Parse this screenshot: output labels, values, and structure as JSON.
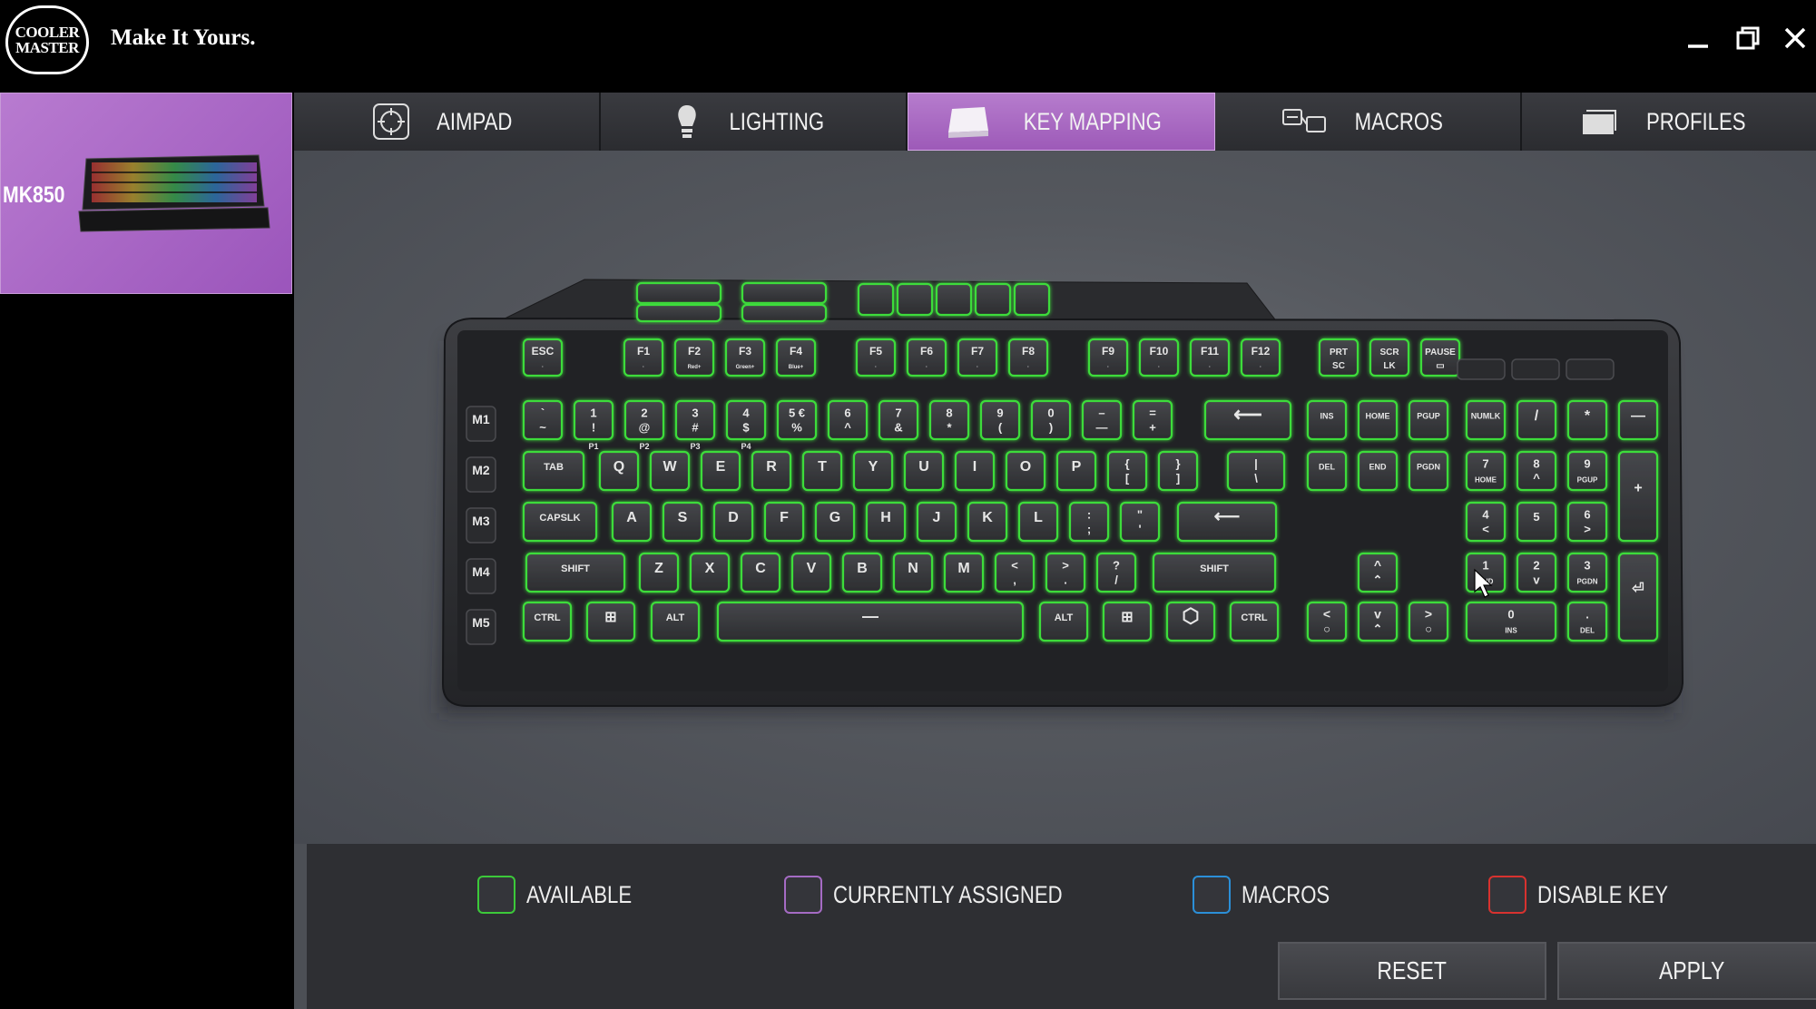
{
  "app": {
    "logo_lines": [
      "COOLER",
      "MASTER"
    ],
    "tagline": "Make It Yours.",
    "window_controls": [
      "minimize",
      "restore",
      "close"
    ]
  },
  "sidebar": {
    "device": {
      "name": "MK850",
      "selected": true,
      "color": "#a864c4"
    }
  },
  "tabs": [
    {
      "label": "AIMPAD",
      "icon": "crosshair-icon",
      "active": false
    },
    {
      "label": "LIGHTING",
      "icon": "bulb-icon",
      "active": false
    },
    {
      "label": "KEY MAPPING",
      "icon": "keyboard-icon",
      "active": true
    },
    {
      "label": "MACROS",
      "icon": "macro-icon",
      "active": false
    },
    {
      "label": "PROFILES",
      "icon": "profiles-icon",
      "active": false
    }
  ],
  "keyboard": {
    "available_color": "#3ddc3a",
    "side_keys": [
      "M1",
      "M2",
      "M3",
      "M4",
      "M5"
    ],
    "function_row": [
      "ESC",
      "F1",
      "F2",
      "F3",
      "F4",
      "F5",
      "F6",
      "F7",
      "F8",
      "F9",
      "F10",
      "F11",
      "F12"
    ],
    "f_sublabels": [
      "",
      "",
      "Red+",
      "Green+",
      "Blue+",
      "",
      "",
      "",
      "",
      "",
      "",
      "",
      ""
    ],
    "system_keys": [
      {
        "main": "PRT",
        "sub": "SC"
      },
      {
        "main": "SCR",
        "sub": "LK"
      },
      {
        "main": "PAUSE",
        "sub": ""
      }
    ],
    "number_row": [
      {
        "top": "`",
        "bottom": "~"
      },
      {
        "top": "1",
        "bottom": "!"
      },
      {
        "top": "2",
        "bottom": "@"
      },
      {
        "top": "3",
        "bottom": "#"
      },
      {
        "top": "4",
        "bottom": "$"
      },
      {
        "top": "5 €",
        "bottom": "%"
      },
      {
        "top": "6",
        "bottom": "^"
      },
      {
        "top": "7",
        "bottom": "&"
      },
      {
        "top": "8",
        "bottom": "*"
      },
      {
        "top": "9",
        "bottom": "("
      },
      {
        "top": "0",
        "bottom": ")"
      },
      {
        "top": "–",
        "bottom": "—"
      },
      {
        "top": "=",
        "bottom": "+"
      }
    ],
    "p_labels": [
      "P1",
      "P2",
      "P3",
      "P4"
    ],
    "qwerty_row": [
      "Q",
      "W",
      "E",
      "R",
      "T",
      "Y",
      "U",
      "I",
      "O",
      "P"
    ],
    "qwerty_extra": [
      {
        "top": "{",
        "bottom": "["
      },
      {
        "top": "}",
        "bottom": "]"
      },
      {
        "top": "|",
        "bottom": "\\"
      }
    ],
    "home_row": [
      "A",
      "S",
      "D",
      "F",
      "G",
      "H",
      "J",
      "K",
      "L"
    ],
    "home_extra": [
      {
        "top": ":",
        "bottom": ";"
      },
      {
        "top": "\"",
        "bottom": "'"
      }
    ],
    "bottom_alpha_row": [
      "Z",
      "X",
      "C",
      "V",
      "B",
      "N",
      "M"
    ],
    "bottom_alpha_extra": [
      {
        "top": "<",
        "bottom": ","
      },
      {
        "top": ">",
        "bottom": "."
      },
      {
        "top": "?",
        "bottom": "/"
      }
    ],
    "modifier_labels": {
      "tab": "TAB",
      "capslock": "CAPSLK",
      "shift": "SHIFT",
      "ctrl": "CTRL",
      "alt": "ALT"
    },
    "nav_keys": [
      "INS",
      "HOME",
      "PGUP",
      "DEL",
      "END",
      "PGDN"
    ],
    "numpad": {
      "top": [
        "NUMLK",
        "/",
        "*",
        "—"
      ],
      "row7": [
        {
          "top": "7",
          "bottom": "HOME"
        },
        {
          "top": "8",
          "bottom": "^"
        },
        {
          "top": "9",
          "bottom": "PGUP"
        }
      ],
      "row4": [
        {
          "top": "4",
          "bottom": "<"
        },
        {
          "top": "5",
          "bottom": ""
        },
        {
          "top": "6",
          "bottom": ">"
        }
      ],
      "row1": [
        {
          "top": "1",
          "bottom": "END"
        },
        {
          "top": "2",
          "bottom": "v"
        },
        {
          "top": "3",
          "bottom": "PGDN"
        }
      ],
      "zero": {
        "top": "0",
        "bottom": "INS"
      },
      "dot": {
        "top": ".",
        "bottom": "DEL"
      },
      "plus": "+"
    }
  },
  "legend": [
    {
      "label": "AVAILABLE",
      "color": "#3cc93a"
    },
    {
      "label": "CURRENTLY ASSIGNED",
      "color": "#a56bc4"
    },
    {
      "label": "MACROS",
      "color": "#2b8fd8"
    },
    {
      "label": "DISABLE KEY",
      "color": "#d8322f"
    }
  ],
  "actions": {
    "reset": "RESET",
    "apply": "APPLY"
  }
}
